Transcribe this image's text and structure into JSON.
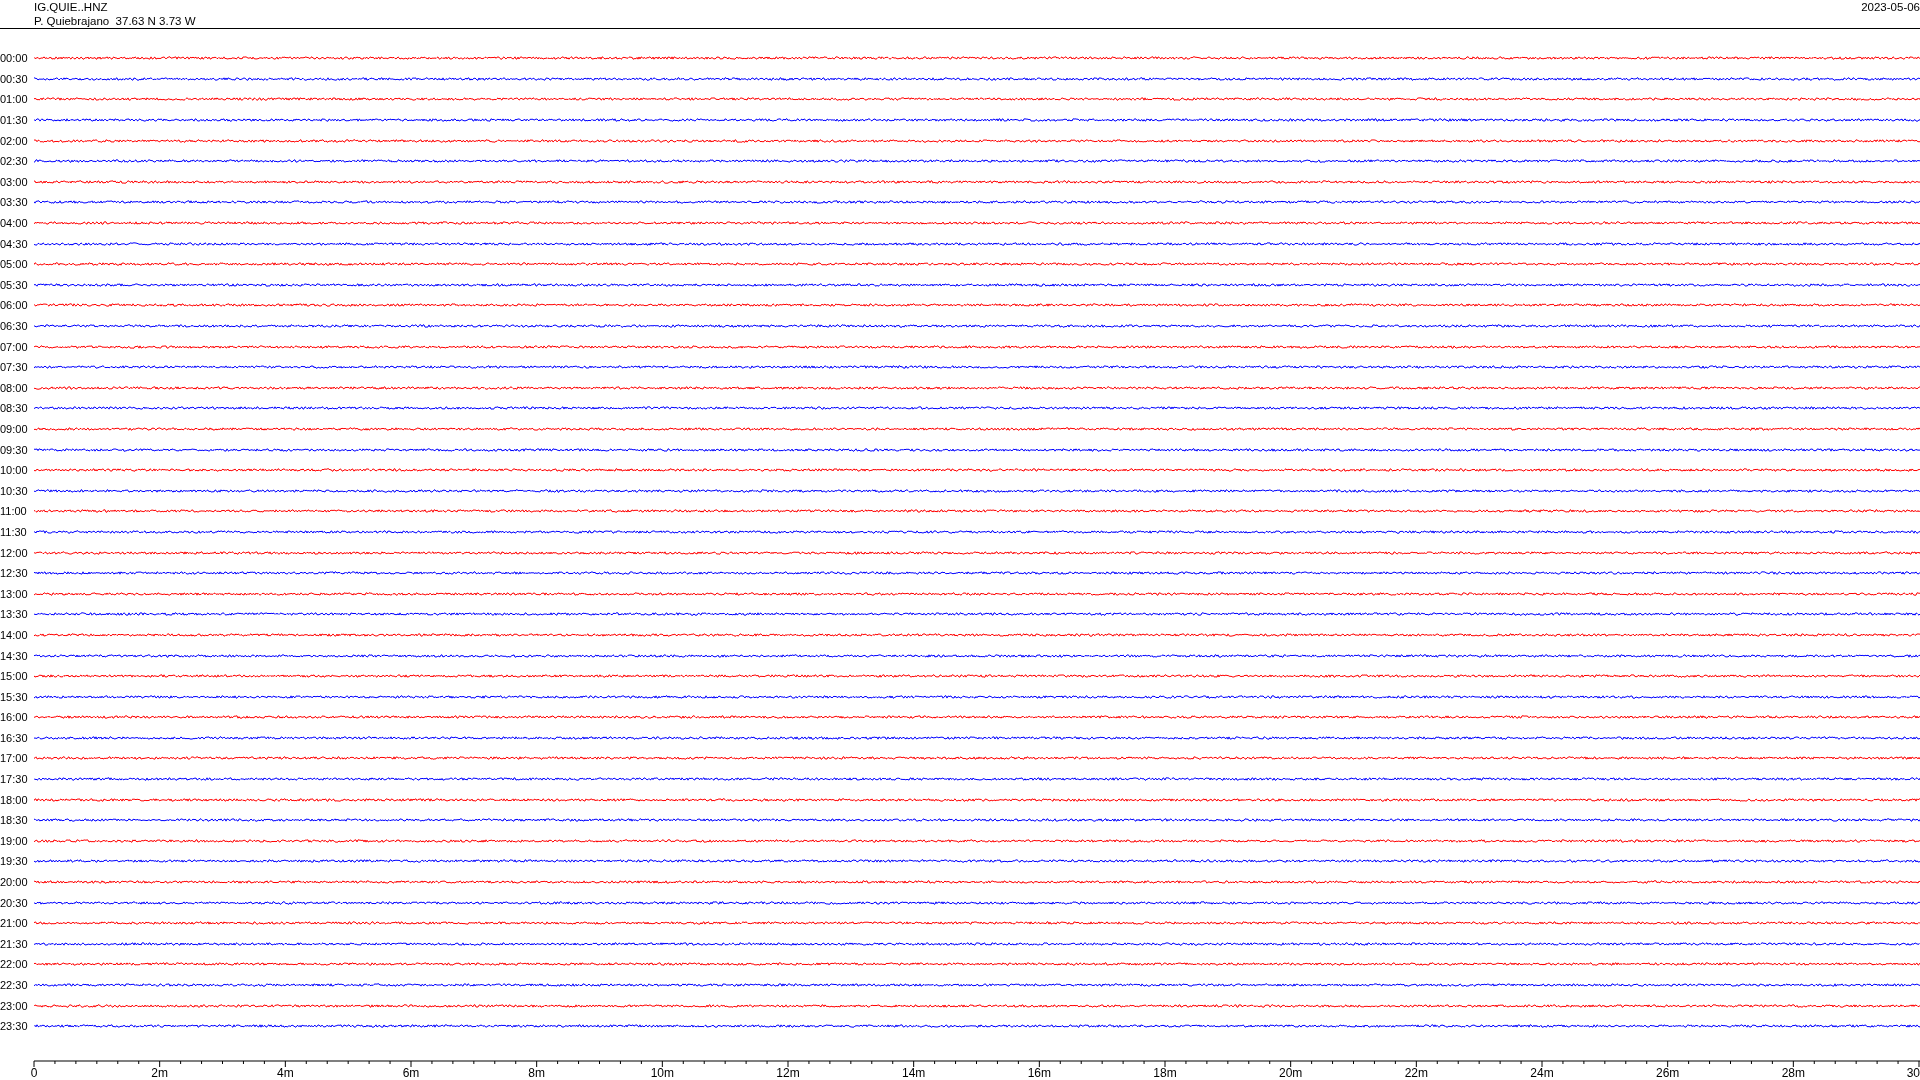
{
  "header": {
    "station": "IG.QUIE..HNZ",
    "location": "P. Quiebrajano  37.63 N 3.73 W",
    "date": "2023-05-06"
  },
  "traces": [
    {
      "label": "00:00",
      "color": "#ff0000"
    },
    {
      "label": "00:30",
      "color": "#0000ff"
    },
    {
      "label": "01:00",
      "color": "#ff0000"
    },
    {
      "label": "01:30",
      "color": "#0000ff"
    },
    {
      "label": "02:00",
      "color": "#ff0000"
    },
    {
      "label": "02:30",
      "color": "#0000ff"
    },
    {
      "label": "03:00",
      "color": "#ff0000"
    },
    {
      "label": "03:30",
      "color": "#0000ff"
    },
    {
      "label": "04:00",
      "color": "#ff0000"
    },
    {
      "label": "04:30",
      "color": "#0000ff"
    },
    {
      "label": "05:00",
      "color": "#ff0000"
    },
    {
      "label": "05:30",
      "color": "#0000ff"
    },
    {
      "label": "06:00",
      "color": "#ff0000"
    },
    {
      "label": "06:30",
      "color": "#0000ff"
    },
    {
      "label": "07:00",
      "color": "#ff0000"
    },
    {
      "label": "07:30",
      "color": "#0000ff"
    },
    {
      "label": "08:00",
      "color": "#ff0000"
    },
    {
      "label": "08:30",
      "color": "#0000ff"
    },
    {
      "label": "09:00",
      "color": "#ff0000"
    },
    {
      "label": "09:30",
      "color": "#0000ff"
    },
    {
      "label": "10:00",
      "color": "#ff0000"
    },
    {
      "label": "10:30",
      "color": "#0000ff"
    },
    {
      "label": "11:00",
      "color": "#ff0000"
    },
    {
      "label": "11:30",
      "color": "#0000ff"
    },
    {
      "label": "12:00",
      "color": "#ff0000"
    },
    {
      "label": "12:30",
      "color": "#0000ff"
    },
    {
      "label": "13:00",
      "color": "#ff0000"
    },
    {
      "label": "13:30",
      "color": "#0000ff"
    },
    {
      "label": "14:00",
      "color": "#ff0000"
    },
    {
      "label": "14:30",
      "color": "#0000ff"
    },
    {
      "label": "15:00",
      "color": "#ff0000"
    },
    {
      "label": "15:30",
      "color": "#0000ff"
    },
    {
      "label": "16:00",
      "color": "#ff0000"
    },
    {
      "label": "16:30",
      "color": "#0000ff"
    },
    {
      "label": "17:00",
      "color": "#ff0000"
    },
    {
      "label": "17:30",
      "color": "#0000ff"
    },
    {
      "label": "18:00",
      "color": "#ff0000"
    },
    {
      "label": "18:30",
      "color": "#0000ff"
    },
    {
      "label": "19:00",
      "color": "#ff0000"
    },
    {
      "label": "19:30",
      "color": "#0000ff"
    },
    {
      "label": "20:00",
      "color": "#ff0000"
    },
    {
      "label": "20:30",
      "color": "#0000ff"
    },
    {
      "label": "21:00",
      "color": "#ff0000"
    },
    {
      "label": "21:30",
      "color": "#0000ff"
    },
    {
      "label": "22:00",
      "color": "#ff0000"
    },
    {
      "label": "22:30",
      "color": "#0000ff"
    },
    {
      "label": "23:00",
      "color": "#ff0000"
    },
    {
      "label": "23:30",
      "color": "#0000ff"
    }
  ],
  "time_axis": {
    "labels": [
      "0",
      "2m",
      "4m",
      "6m",
      "8m",
      "10m",
      "12m",
      "14m",
      "16m",
      "18m",
      "20m",
      "22m",
      "24m",
      "26m",
      "28m",
      "30"
    ]
  }
}
